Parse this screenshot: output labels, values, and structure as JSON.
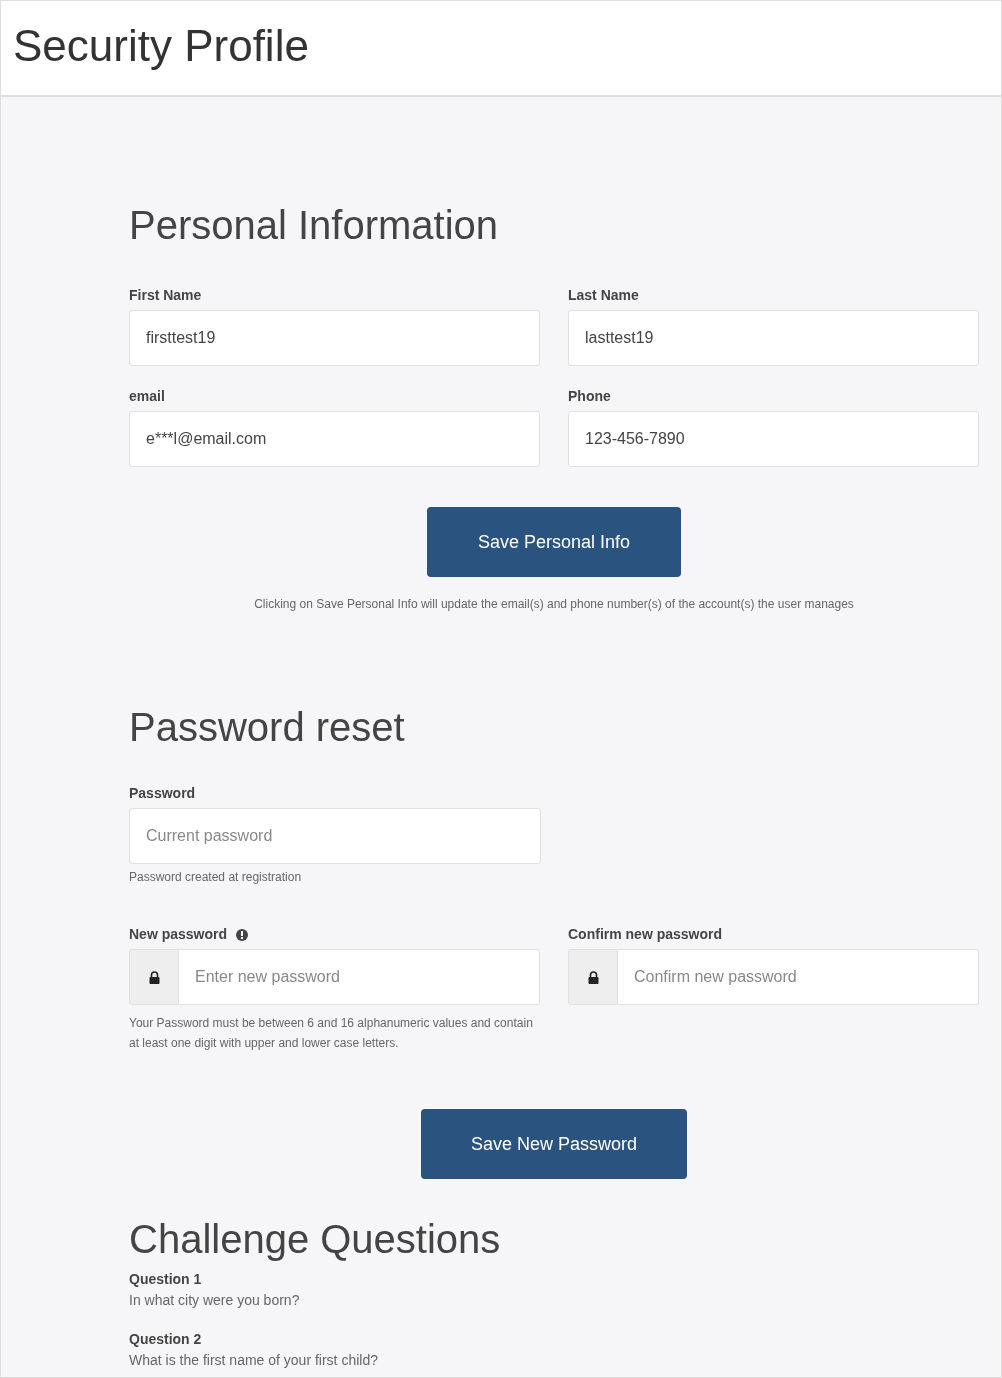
{
  "page_title": "Security Profile",
  "personal": {
    "heading": "Personal Information",
    "fields": [
      {
        "label": "First Name",
        "value": "firsttest19"
      },
      {
        "label": "Last Name",
        "value": "lasttest19"
      },
      {
        "label": "email",
        "value": "e***l@email.com"
      },
      {
        "label": "Phone",
        "value": "123-456-7890"
      }
    ],
    "button": "Save Personal Info",
    "note": "Clicking on Save Personal Info will update the email(s) and phone number(s) of the account(s) the user manages"
  },
  "password": {
    "heading": "Password reset",
    "current": {
      "label": "Password",
      "placeholder": "Current password",
      "help": "Password created at registration"
    },
    "new": {
      "label": "New password",
      "placeholder": "Enter new password",
      "help": "Your Password must be between 6 and 16 alphanumeric values and contain at least one digit with upper and lower case letters."
    },
    "confirm": {
      "label": "Confirm new password",
      "placeholder": "Confirm new password"
    },
    "button": "Save New Password"
  },
  "challenge": {
    "heading": "Challenge Questions",
    "questions": [
      {
        "label": "Question 1",
        "text": "In what city were you born?"
      },
      {
        "label": "Question 2",
        "text": "What is the first name of your first child?"
      }
    ]
  }
}
